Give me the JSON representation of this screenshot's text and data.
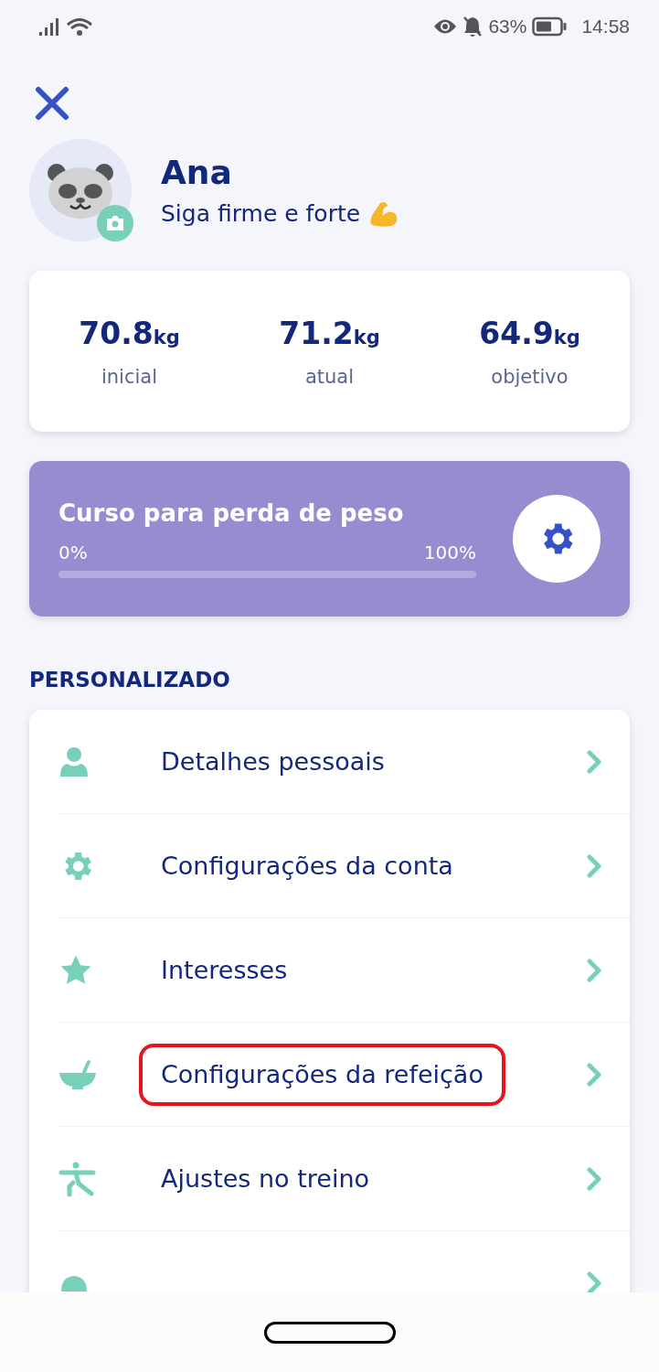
{
  "status_bar": {
    "battery": "63%",
    "time": "14:58"
  },
  "profile": {
    "name": "Ana",
    "motto": "Siga firme e forte"
  },
  "stats": [
    {
      "value": "70.8",
      "unit": "kg",
      "label": "inicial"
    },
    {
      "value": "71.2",
      "unit": "kg",
      "label": "atual"
    },
    {
      "value": "64.9",
      "unit": "kg",
      "label": "objetivo"
    }
  ],
  "course": {
    "title": "Curso para perda de peso",
    "start": "0%",
    "end": "100%",
    "level": 0
  },
  "section_title": "PERSONALIZADO",
  "menu": [
    {
      "kind": "person",
      "label": "Detalhes pessoais",
      "highlighted": false
    },
    {
      "kind": "gear",
      "label": "Configurações da conta",
      "highlighted": false
    },
    {
      "kind": "star",
      "label": "Interesses",
      "highlighted": false
    },
    {
      "kind": "bowl",
      "label": "Configurações da refeição",
      "highlighted": true
    },
    {
      "kind": "exercise",
      "label": "Ajustes no treino",
      "highlighted": false
    },
    {
      "kind": "bell",
      "highlighted": false
    }
  ]
}
